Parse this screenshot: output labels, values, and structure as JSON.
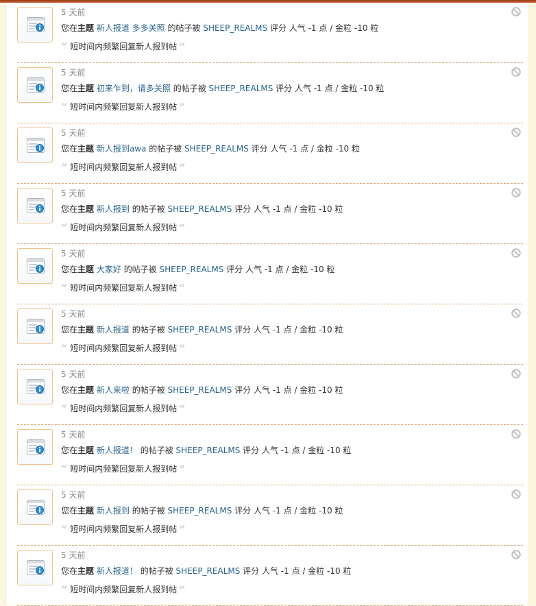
{
  "notifications": [
    {
      "time": "5 天前",
      "prefix": "您在",
      "subject_word": "主题",
      "topic": "新人报道 多多关照",
      "middle": " 的帖子被 ",
      "user": "SHEEP_REALMS",
      "suffix": " 评分 人气 -1 点 / 金粒 -10 粒",
      "reason": "短时间内频繁回复新人报到帖",
      "icon": "notice-icon"
    },
    {
      "time": "5 天前",
      "prefix": "您在",
      "subject_word": "主题",
      "topic": "初来乍到，请多关照",
      "middle": " 的帖子被 ",
      "user": "SHEEP_REALMS",
      "suffix": " 评分 人气 -1 点 / 金粒 -10 粒",
      "reason": "短时间内频繁回复新人报到帖",
      "icon": "notice-icon"
    },
    {
      "time": "5 天前",
      "prefix": "您在",
      "subject_word": "主题",
      "topic": "新人报到awa",
      "middle": " 的帖子被 ",
      "user": "SHEEP_REALMS",
      "suffix": " 评分 人气 -1 点 / 金粒 -10 粒",
      "reason": "短时间内频繁回复新人报到帖",
      "icon": "notice-icon"
    },
    {
      "time": "5 天前",
      "prefix": "您在",
      "subject_word": "主题",
      "topic": "新人报到",
      "middle": " 的帖子被 ",
      "user": "SHEEP_REALMS",
      "suffix": " 评分 人气 -1 点 / 金粒 -10 粒",
      "reason": "短时间内频繁回复新人报到帖",
      "icon": "notice-icon"
    },
    {
      "time": "5 天前",
      "prefix": "您在",
      "subject_word": "主题",
      "topic": "大家好",
      "middle": " 的帖子被 ",
      "user": "SHEEP_REALMS",
      "suffix": " 评分 人气 -1 点 / 金粒 -10 粒",
      "reason": "短时间内频繁回复新人报到帖",
      "icon": "notice-icon"
    },
    {
      "time": "5 天前",
      "prefix": "您在",
      "subject_word": "主题",
      "topic": "新人报道",
      "middle": " 的帖子被 ",
      "user": "SHEEP_REALMS",
      "suffix": " 评分 人气 -1 点 / 金粒 -10 粒",
      "reason": "短时间内频繁回复新人报到帖",
      "icon": "notice-icon"
    },
    {
      "time": "5 天前",
      "prefix": "您在",
      "subject_word": "主题",
      "topic": "新人来啦",
      "middle": " 的帖子被 ",
      "user": "SHEEP_REALMS",
      "suffix": " 评分 人气 -1 点 / 金粒 -10 粒",
      "reason": "短时间内频繁回复新人报到帖",
      "icon": "notice-icon"
    },
    {
      "time": "5 天前",
      "prefix": "您在",
      "subject_word": "主题",
      "topic": "新人报道！",
      "middle": " 的帖子被 ",
      "user": "SHEEP_REALMS",
      "suffix": " 评分 人气 -1 点 / 金粒 -10 粒",
      "reason": "短时间内频繁回复新人报到帖",
      "icon": "notice-icon"
    },
    {
      "time": "5 天前",
      "prefix": "您在",
      "subject_word": "主题",
      "topic": "新人报到",
      "middle": " 的帖子被 ",
      "user": "SHEEP_REALMS",
      "suffix": " 评分 人气 -1 点 / 金粒 -10 粒",
      "reason": "短时间内频繁回复新人报到帖",
      "icon": "notice-icon"
    },
    {
      "time": "5 天前",
      "prefix": "您在",
      "subject_word": "主题",
      "topic": "新人报道！",
      "middle": " 的帖子被 ",
      "user": "SHEEP_REALMS",
      "suffix": " 评分 人气 -1 点 / 金粒 -10 粒",
      "reason": "短时间内频繁回复新人报到帖",
      "icon": "notice-icon"
    }
  ],
  "glyphs": {
    "quote_open": "“",
    "quote_close": "”"
  },
  "colors": {
    "link": "#29648f",
    "divider": "#e0a36c",
    "time": "#8a8a8a",
    "avatar_border": "#f0c28c"
  }
}
